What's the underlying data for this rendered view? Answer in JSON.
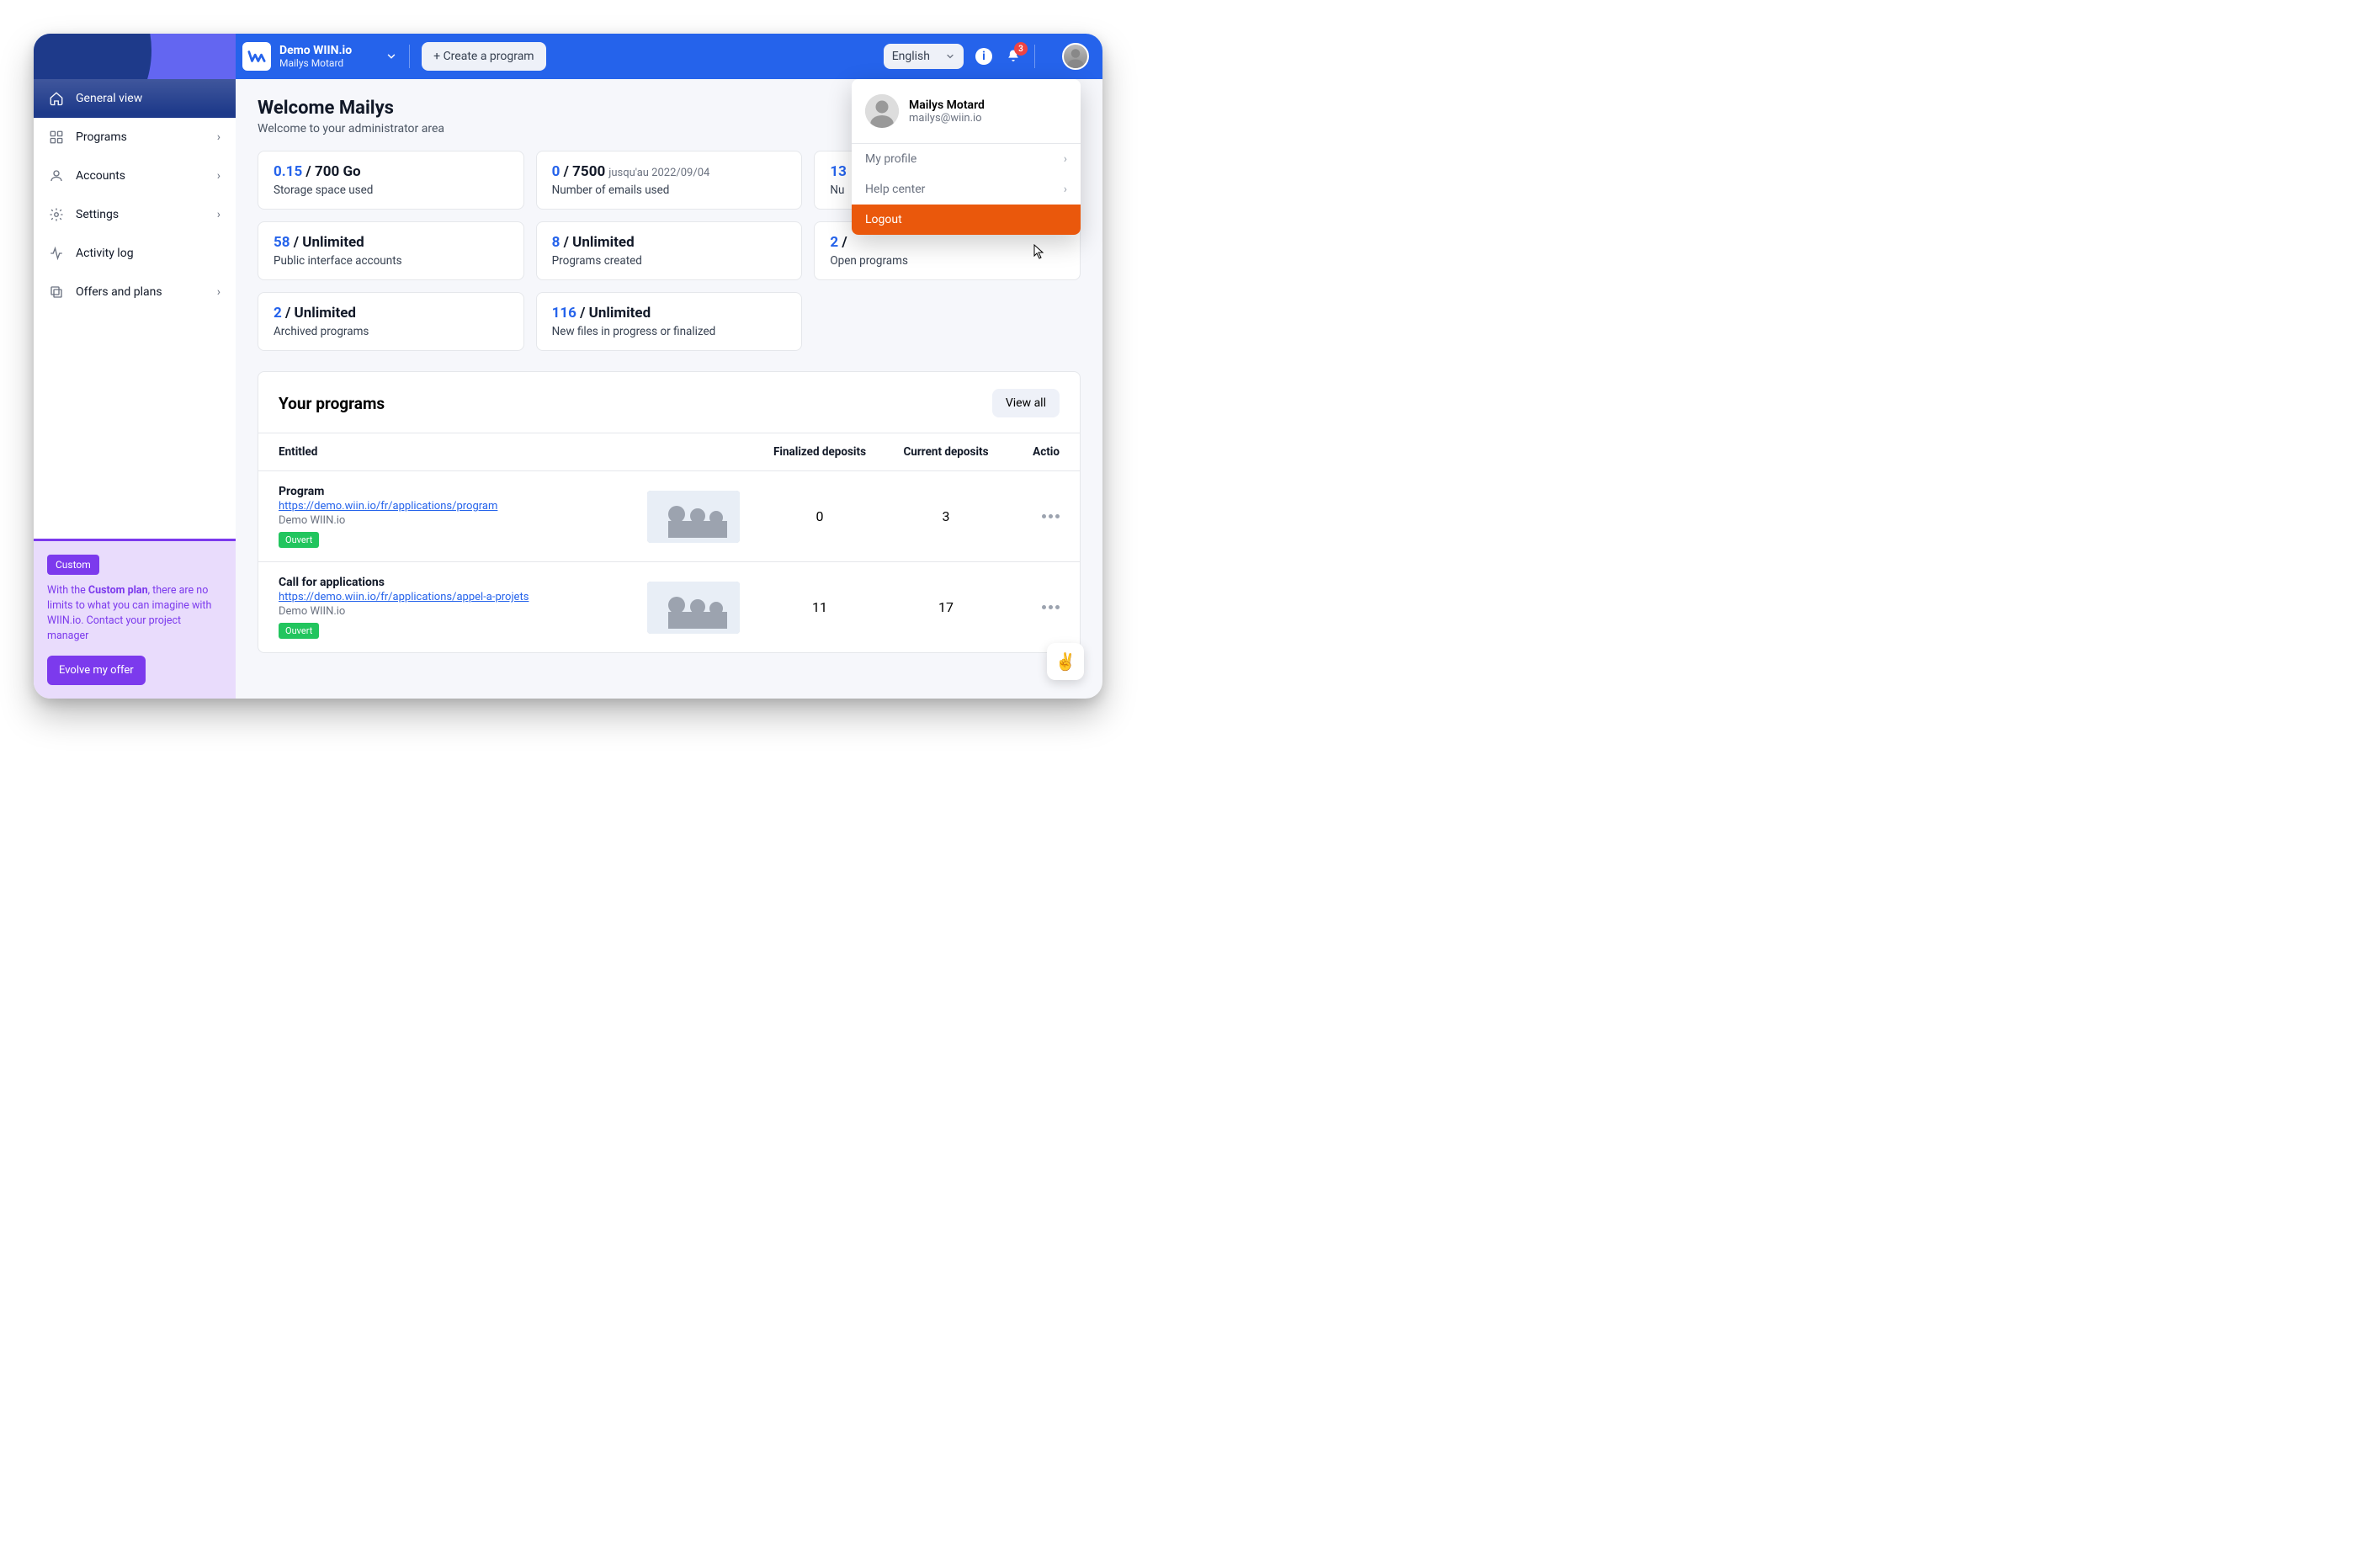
{
  "header": {
    "org": "Demo WIIN.io",
    "user": "Mailys Motard",
    "create_label": "+ Create a program",
    "language": "English",
    "notif_count": "3"
  },
  "sidebar": {
    "items": [
      {
        "label": "General view",
        "icon": "home",
        "active": true,
        "chev": false
      },
      {
        "label": "Programs",
        "icon": "grid",
        "active": false,
        "chev": true
      },
      {
        "label": "Accounts",
        "icon": "user",
        "active": false,
        "chev": true
      },
      {
        "label": "Settings",
        "icon": "gear",
        "active": false,
        "chev": true
      },
      {
        "label": "Activity log",
        "icon": "activity",
        "active": false,
        "chev": false
      },
      {
        "label": "Offers and plans",
        "icon": "copy",
        "active": false,
        "chev": true
      }
    ]
  },
  "promo": {
    "tag": "Custom",
    "text_before": "With the ",
    "text_bold": "Custom plan",
    "text_after": ", there are no limits to what you can imagine with WIIN.io. Contact your project manager",
    "cta": "Evolve my offer"
  },
  "page": {
    "title": "Welcome Mailys",
    "subtitle": "Welcome to your administrator area"
  },
  "stats": [
    {
      "blue": "0.15",
      "rest": " / 700 Go",
      "suffix": "",
      "desc": "Storage space used"
    },
    {
      "blue": "0",
      "rest": " / 7500",
      "suffix": "jusqu'au 2022/09/04",
      "desc": "Number of emails used"
    },
    {
      "blue": "13",
      "rest": "",
      "suffix": "",
      "desc": "Nu"
    },
    {
      "blue": "58",
      "rest": " / Unlimited",
      "suffix": "",
      "desc": "Public interface accounts"
    },
    {
      "blue": "8",
      "rest": " / Unlimited",
      "suffix": "",
      "desc": "Programs created"
    },
    {
      "blue": "2",
      "rest": " /",
      "suffix": "",
      "desc": "Open programs"
    },
    {
      "blue": "2",
      "rest": " / Unlimited",
      "suffix": "",
      "desc": "Archived programs"
    },
    {
      "blue": "116",
      "rest": " / Unlimited",
      "suffix": "",
      "desc": "New files in progress or finalized"
    }
  ],
  "programs_panel": {
    "title": "Your programs",
    "view_all": "View all",
    "columns": {
      "entitled": "Entitled",
      "finalized": "Finalized deposits",
      "current": "Current deposits",
      "actions": "Actio"
    },
    "rows": [
      {
        "title": "Program",
        "url": "https://demo.wiin.io/fr/applications/program",
        "org": "Demo WIIN.io",
        "status": "Ouvert",
        "finalized": "0",
        "current": "3"
      },
      {
        "title": "Call for applications",
        "url": "https://demo.wiin.io/fr/applications/appel-a-projets",
        "org": "Demo WIIN.io",
        "status": "Ouvert",
        "finalized": "11",
        "current": "17"
      }
    ]
  },
  "dropdown": {
    "name": "Mailys Motard",
    "email": "mailys@wiin.io",
    "my_profile": "My profile",
    "help_center": "Help center",
    "logout": "Logout"
  },
  "fab": "✌️"
}
